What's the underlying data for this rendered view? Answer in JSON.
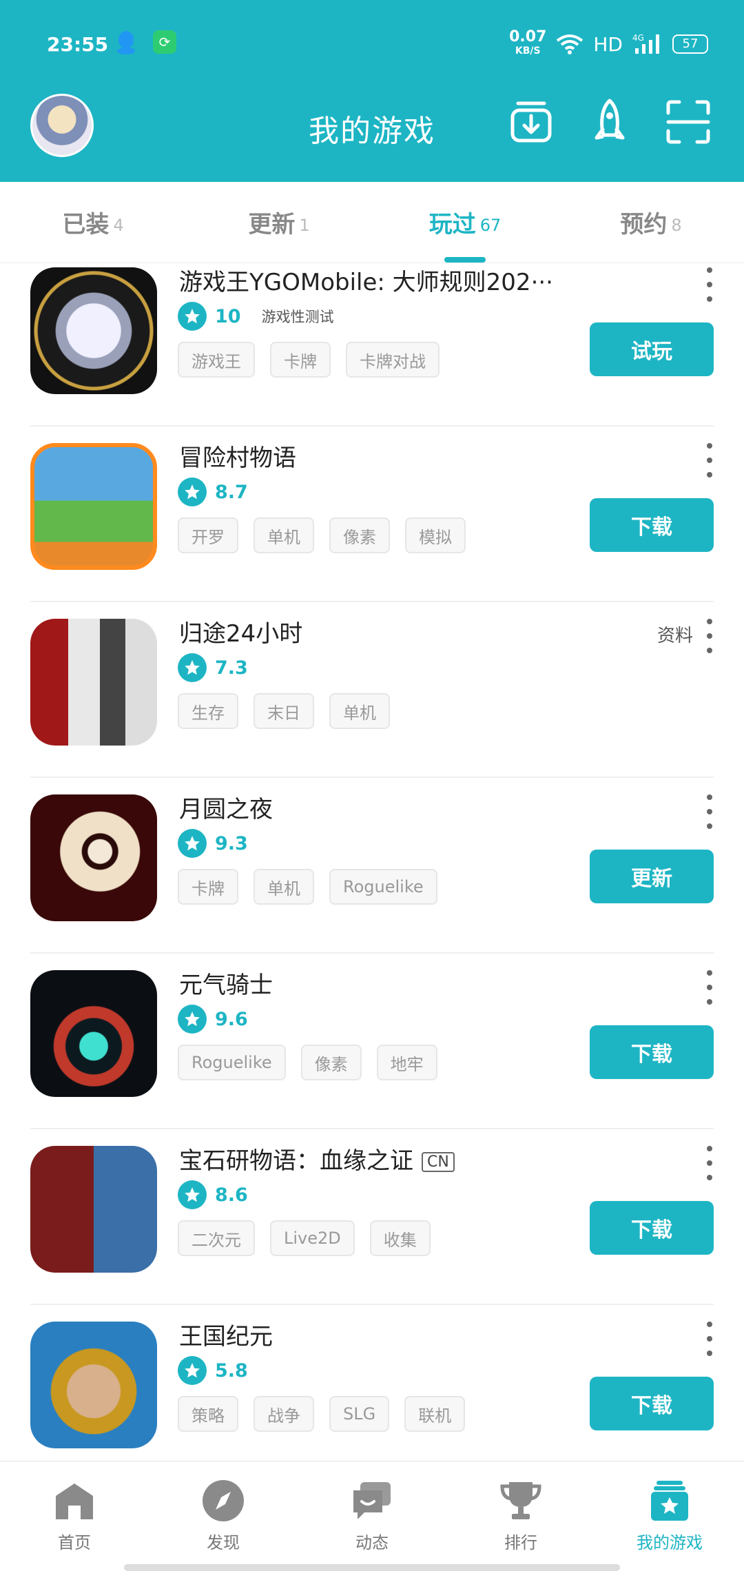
{
  "status": {
    "time": "23:55",
    "net_speed": "0.07",
    "net_unit": "KB/S",
    "network": "HD",
    "signal": "4G",
    "battery": "57"
  },
  "header": {
    "title": "我的游戏"
  },
  "tabs": [
    {
      "label": "已装",
      "count": "4"
    },
    {
      "label": "更新",
      "count": "1"
    },
    {
      "label": "玩过",
      "count": "67"
    },
    {
      "label": "预约",
      "count": "8"
    }
  ],
  "games": [
    {
      "name": "游戏王YGOMobile: 大师规则202···",
      "rating": "10",
      "rating_note": "游戏性测试",
      "tags": [
        "游戏王",
        "卡牌",
        "卡牌对战"
      ],
      "action": "试玩"
    },
    {
      "name": "冒险村物语",
      "rating": "8.7",
      "tags": [
        "开罗",
        "单机",
        "像素",
        "模拟"
      ],
      "action": "下载"
    },
    {
      "name": "归途24小时",
      "rating": "7.3",
      "tags": [
        "生存",
        "末日",
        "单机"
      ],
      "info_link": "资料"
    },
    {
      "name": "月圆之夜",
      "rating": "9.3",
      "tags": [
        "卡牌",
        "单机",
        "Roguelike"
      ],
      "action": "更新"
    },
    {
      "name": "元气骑士",
      "rating": "9.6",
      "tags": [
        "Roguelike",
        "像素",
        "地牢"
      ],
      "action": "下载"
    },
    {
      "name": "宝石研物语：血缘之证",
      "badge": "CN",
      "rating": "8.6",
      "tags": [
        "二次元",
        "Live2D",
        "收集"
      ],
      "action": "下载"
    },
    {
      "name": "王国纪元",
      "rating": "5.8",
      "tags": [
        "策略",
        "战争",
        "SLG",
        "联机"
      ],
      "action": "下载"
    }
  ],
  "bottom_nav": [
    {
      "label": "首页",
      "icon": "home-icon"
    },
    {
      "label": "发现",
      "icon": "compass-icon"
    },
    {
      "label": "动态",
      "icon": "chat-icon"
    },
    {
      "label": "排行",
      "icon": "trophy-icon"
    },
    {
      "label": "我的游戏",
      "icon": "my-games-icon"
    }
  ],
  "colors": {
    "accent": "#1db5c4"
  }
}
